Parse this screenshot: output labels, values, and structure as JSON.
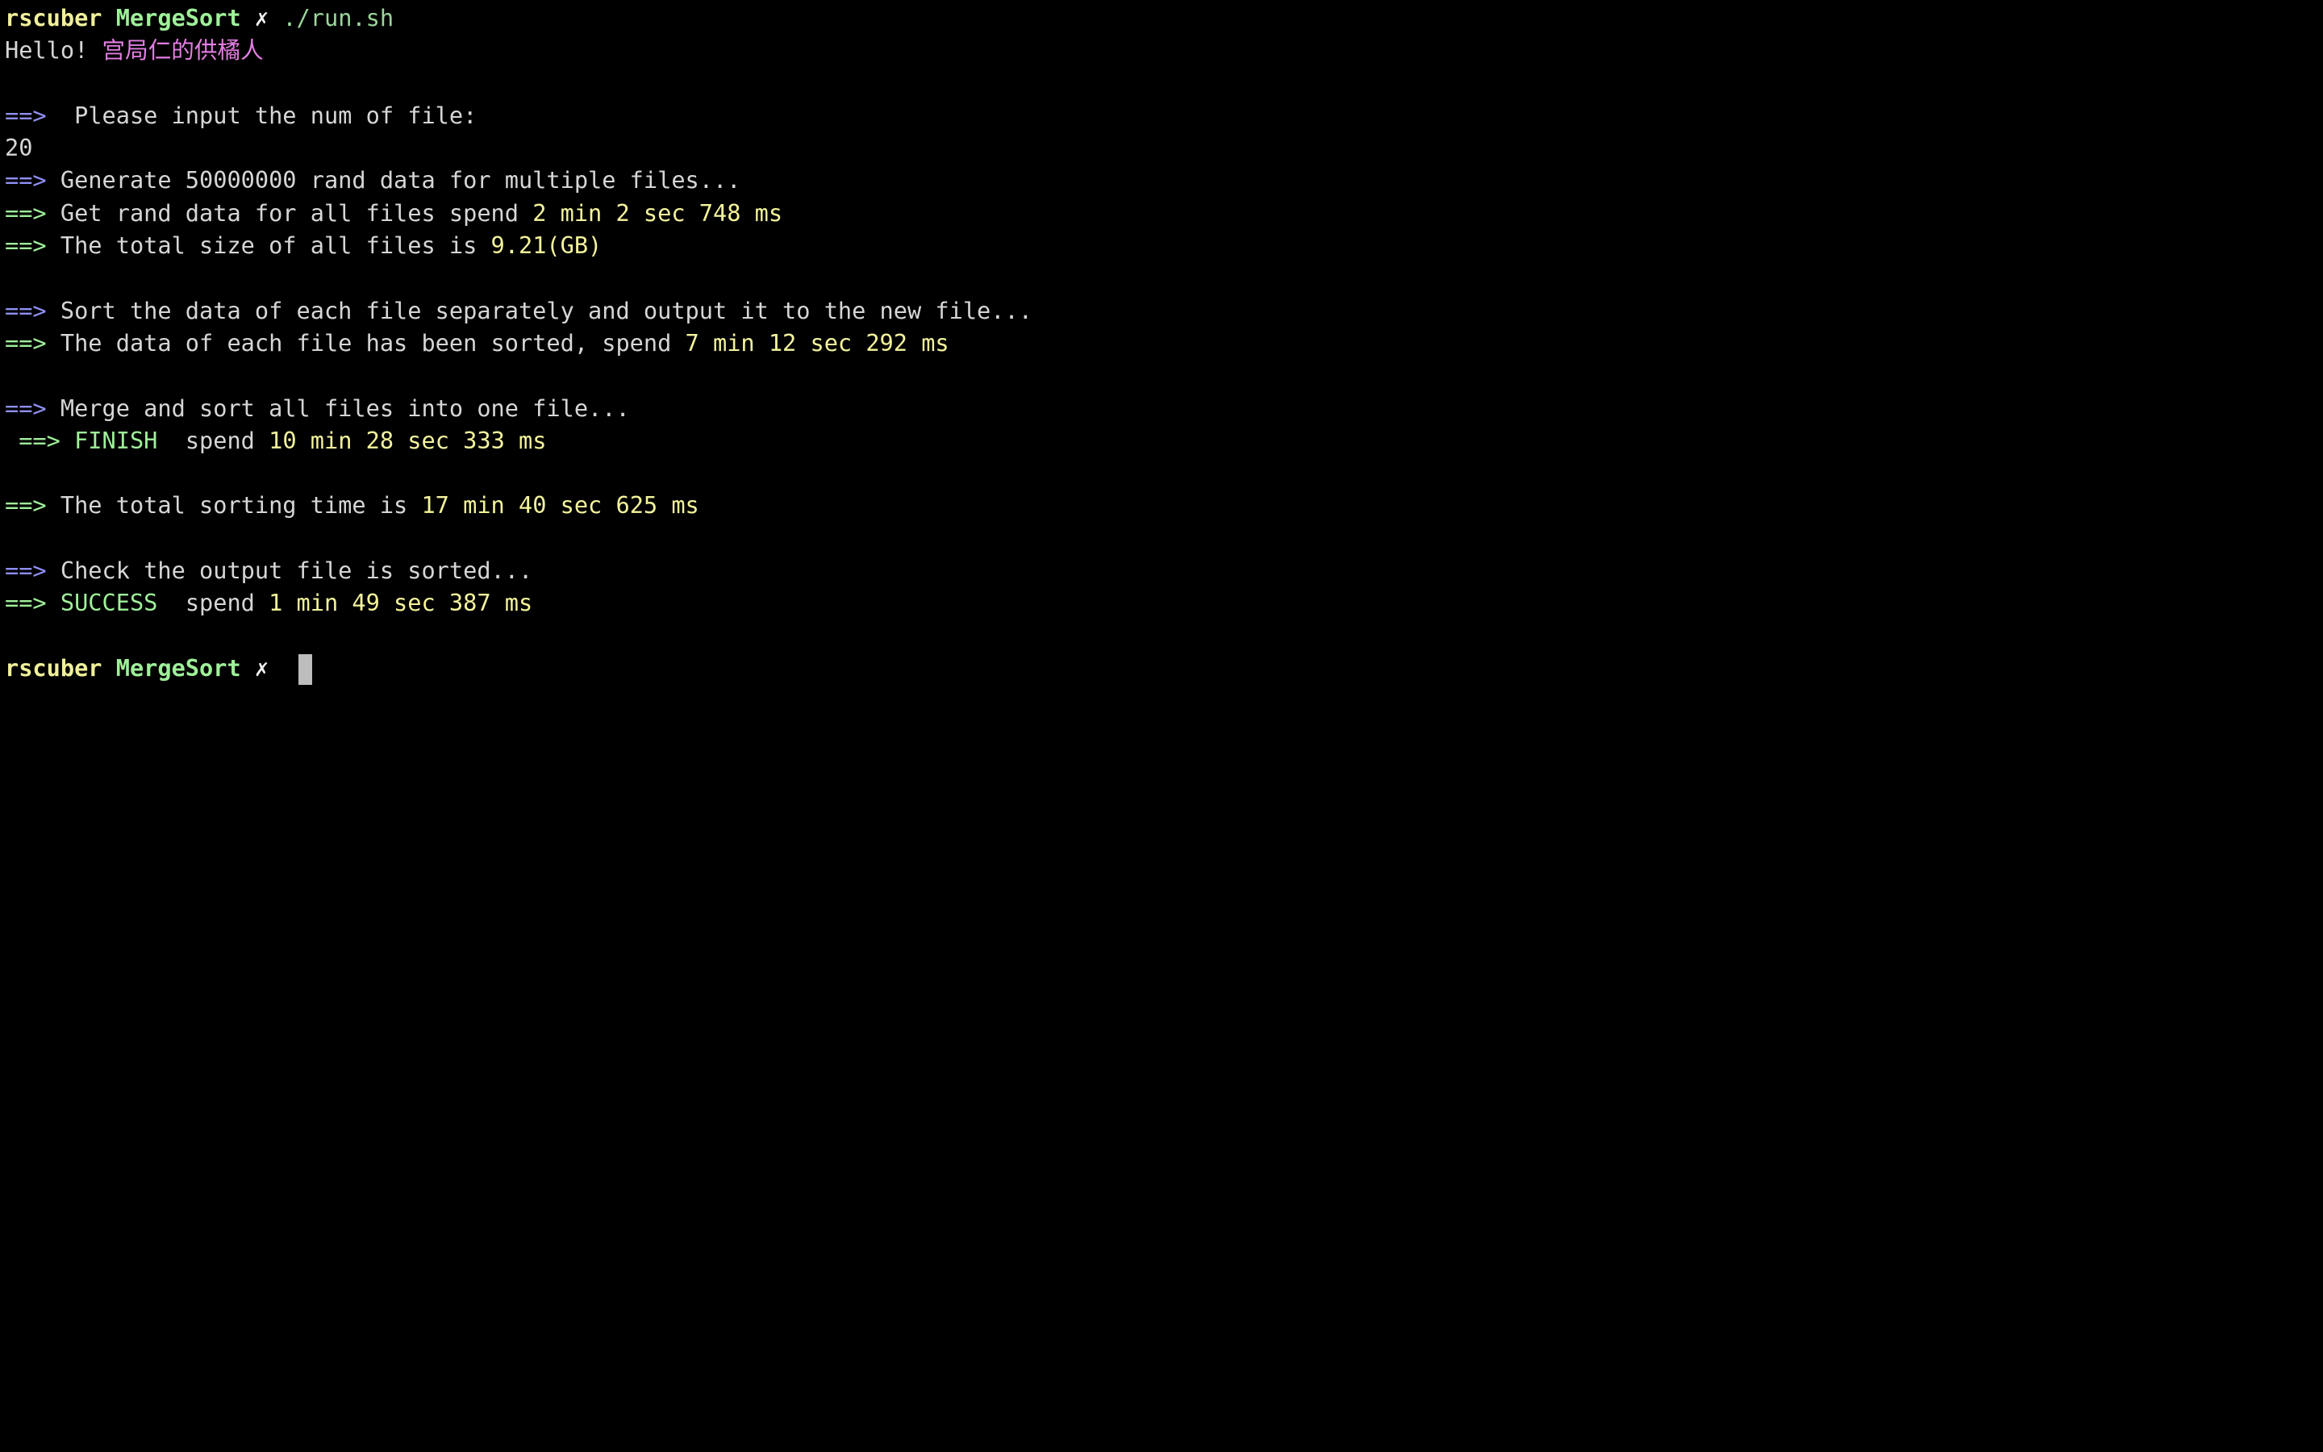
{
  "prompt": {
    "user": "rscuber",
    "dir": "MergeSort",
    "mark": "✗",
    "cursor_gap": "  "
  },
  "cmd": "./run.sh",
  "hello": {
    "text": "Hello! ",
    "name": "宫局仁的供橘人"
  },
  "arrow": "==>",
  "lines": {
    "input_prompt": "  Please input the num of file:",
    "input_value": "20",
    "generate": " Generate 50000000 rand data for multiple files...",
    "get_rand_text": " Get rand data for all files spend ",
    "get_rand_time": "2 min 2 sec 748 ms",
    "total_size_text": " The total size of all files is ",
    "total_size_value": "9.21(GB)",
    "sort_each": " Sort the data of each file separately and output it to the new file...",
    "sorted_text": " The data of each file has been sorted, spend ",
    "sorted_time": "7 min 12 sec 292 ms",
    "merge": " Merge and sort all files into one file...",
    "finish_indent": " ",
    "finish_label": " FINISH",
    "finish_spend": "  spend ",
    "finish_time": "10 min 28 sec 333 ms",
    "total_sort_text": " The total sorting time is ",
    "total_sort_time": "17 min 40 sec 625 ms",
    "check": " Check the output file is sorted...",
    "success_label": " SUCCESS",
    "success_spend": "  spend ",
    "success_time": "1 min 49 sec 387 ms"
  },
  "colors": {
    "background": "#000000",
    "prompt_user": "#f0f09a",
    "prompt_dir": "#9ff09a",
    "arrow_blue": "#8f8ff5",
    "arrow_green": "#9ff09a",
    "value_yellow": "#f4f49c",
    "magenta": "#e27ee2",
    "text": "#d6d6d6"
  }
}
